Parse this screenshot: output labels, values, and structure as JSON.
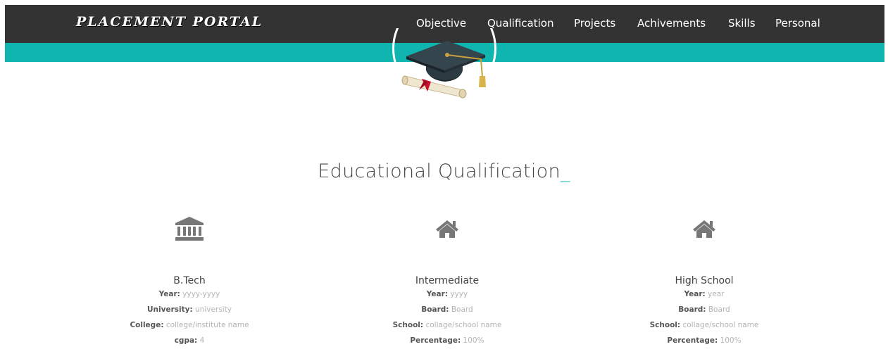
{
  "brand": "PLACEMENT PORTAL",
  "nav": [
    {
      "label": "Objective"
    },
    {
      "label": "Qualification"
    },
    {
      "label": "Projects"
    },
    {
      "label": "Achivements"
    },
    {
      "label": "Skills"
    },
    {
      "label": "Personal"
    }
  ],
  "colors": {
    "navbar": "#333333",
    "accent": "#10b5b0"
  },
  "section": {
    "title": "Educational Qualification",
    "cursor": "_"
  },
  "columns": [
    {
      "icon": "university-icon",
      "heading": "B.Tech",
      "details": [
        {
          "label": "Year:",
          "value": "yyyy-yyyy"
        },
        {
          "label": "University:",
          "value": "university"
        },
        {
          "label": "College:",
          "value": "college/institute name"
        },
        {
          "label": "cgpa:",
          "value": "4"
        }
      ]
    },
    {
      "icon": "home-icon",
      "heading": "Intermediate",
      "details": [
        {
          "label": "Year:",
          "value": "yyyy"
        },
        {
          "label": "Board:",
          "value": "Board"
        },
        {
          "label": "School:",
          "value": "collage/school name"
        },
        {
          "label": "Percentage:",
          "value": "100%"
        }
      ]
    },
    {
      "icon": "home-icon",
      "heading": "High School",
      "details": [
        {
          "label": "Year:",
          "value": "year"
        },
        {
          "label": "Board:",
          "value": "Board"
        },
        {
          "label": "School:",
          "value": "collage/school name"
        },
        {
          "label": "Percentage:",
          "value": "100%"
        }
      ]
    }
  ]
}
